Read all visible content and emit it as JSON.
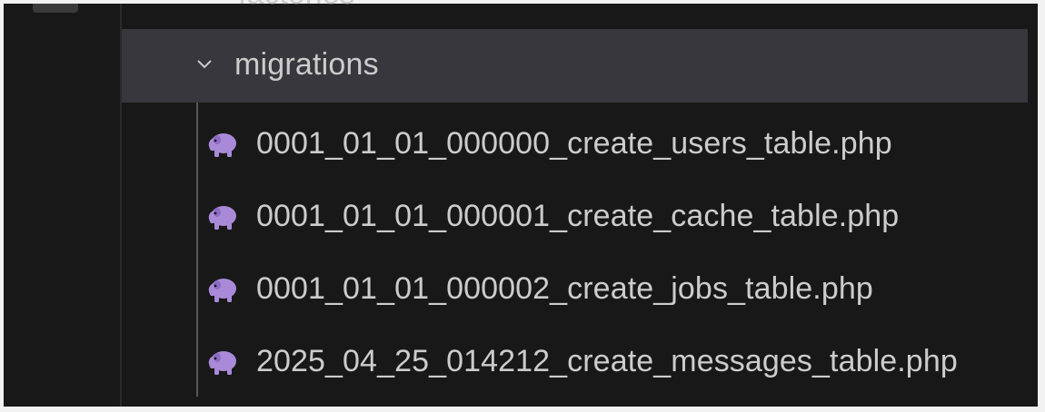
{
  "explorer": {
    "previous_folder": {
      "label": "factories"
    },
    "folder": {
      "label": "migrations",
      "expanded": true,
      "chevron_icon": "chevron-down-icon"
    },
    "files": [
      {
        "label": "0001_01_01_000000_create_users_table.php",
        "icon": "php-elephant-icon"
      },
      {
        "label": "0001_01_01_000001_create_cache_table.php",
        "icon": "php-elephant-icon"
      },
      {
        "label": "0001_01_01_000002_create_jobs_table.php",
        "icon": "php-elephant-icon"
      },
      {
        "label": "2025_04_25_014212_create_messages_table.php",
        "icon": "php-elephant-icon"
      }
    ]
  },
  "colors": {
    "background": "#181818",
    "selected_row": "#37373d",
    "text": "#cccccc",
    "php_icon": "#a98ad8"
  }
}
